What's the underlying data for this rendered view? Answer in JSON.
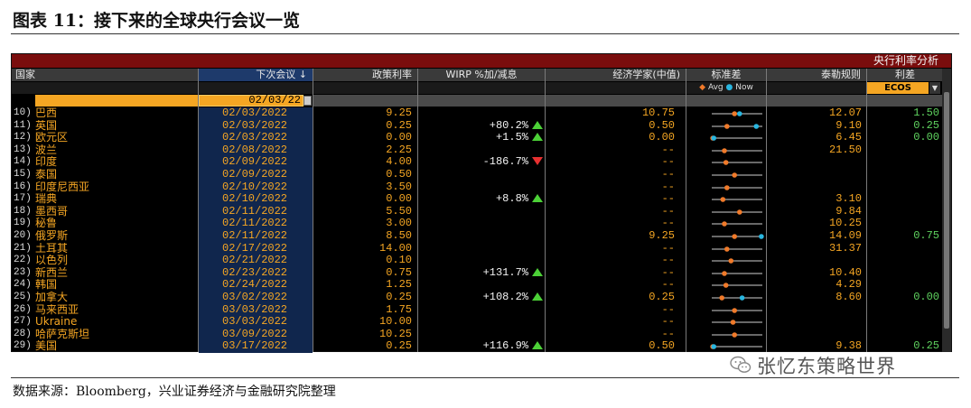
{
  "figure_title": "图表 11：接下来的全球央行会议一览",
  "terminal": {
    "banner_title": "央行利率分析",
    "columns": {
      "country": "国家",
      "next_meeting": "下次会议 ↓",
      "policy_rate": "政策利率",
      "wirp": "WIRP %加/减息",
      "economists": "经济学家(中值)",
      "stdev": "标准差",
      "taylor": "泰勒规则",
      "spread": "利差"
    },
    "legend": {
      "avg": "Avg",
      "now": "Now"
    },
    "spread_source": "ECOS",
    "filter_date": "02/03/22",
    "rows": [
      {
        "idx": "10)",
        "country": "巴西",
        "date": "02/03/2022",
        "rate": "9.25",
        "wirp": "",
        "wirp_dir": "",
        "econ": "10.75",
        "taylor": "12.07",
        "spread": "1.50",
        "avg": 0.45,
        "now": 0.55
      },
      {
        "idx": "11)",
        "country": "英国",
        "date": "02/03/2022",
        "rate": "0.25",
        "wirp": "+80.2%",
        "wirp_dir": "up",
        "econ": "0.50",
        "taylor": "9.10",
        "spread": "0.25",
        "avg": 0.3,
        "now": 0.88
      },
      {
        "idx": "12)",
        "country": "欧元区",
        "date": "02/03/2022",
        "rate": "0.00",
        "wirp": "+1.5%",
        "wirp_dir": "up",
        "econ": "0.00",
        "taylor": "6.45",
        "spread": "0.00",
        "avg": 0.02,
        "now": 0.04
      },
      {
        "idx": "13)",
        "country": "波兰",
        "date": "02/08/2022",
        "rate": "2.25",
        "wirp": "",
        "wirp_dir": "",
        "econ": "--",
        "taylor": "21.50",
        "spread": "",
        "avg": 0.25,
        "now": null
      },
      {
        "idx": "14)",
        "country": "印度",
        "date": "02/09/2022",
        "rate": "4.00",
        "wirp": "-186.7%",
        "wirp_dir": "down",
        "econ": "--",
        "taylor": "",
        "spread": "",
        "avg": 0.28,
        "now": null
      },
      {
        "idx": "15)",
        "country": "泰国",
        "date": "02/09/2022",
        "rate": "0.50",
        "wirp": "",
        "wirp_dir": "",
        "econ": "--",
        "taylor": "",
        "spread": "",
        "avg": 0.45,
        "now": null
      },
      {
        "idx": "16)",
        "country": "印度尼西亚",
        "date": "02/10/2022",
        "rate": "3.50",
        "wirp": "",
        "wirp_dir": "",
        "econ": "--",
        "taylor": "",
        "spread": "",
        "avg": 0.3,
        "now": null
      },
      {
        "idx": "17)",
        "country": "瑞典",
        "date": "02/10/2022",
        "rate": "0.00",
        "wirp": "+8.8%",
        "wirp_dir": "up",
        "econ": "--",
        "taylor": "3.10",
        "spread": "",
        "avg": 0.22,
        "now": null
      },
      {
        "idx": "18)",
        "country": "墨西哥",
        "date": "02/11/2022",
        "rate": "5.50",
        "wirp": "",
        "wirp_dir": "",
        "econ": "--",
        "taylor": "9.84",
        "spread": "",
        "avg": 0.55,
        "now": null
      },
      {
        "idx": "19)",
        "country": "秘鲁",
        "date": "02/11/2022",
        "rate": "3.00",
        "wirp": "",
        "wirp_dir": "",
        "econ": "--",
        "taylor": "10.25",
        "spread": "",
        "avg": 0.25,
        "now": null
      },
      {
        "idx": "20)",
        "country": "俄罗斯",
        "date": "02/11/2022",
        "rate": "8.50",
        "wirp": "",
        "wirp_dir": "",
        "econ": "9.25",
        "taylor": "14.09",
        "spread": "0.75",
        "avg": 0.45,
        "now": 0.98
      },
      {
        "idx": "21)",
        "country": "土耳其",
        "date": "02/17/2022",
        "rate": "14.00",
        "wirp": "",
        "wirp_dir": "",
        "econ": "--",
        "taylor": "31.37",
        "spread": "",
        "avg": 0.3,
        "now": null
      },
      {
        "idx": "22)",
        "country": "以色列",
        "date": "02/21/2022",
        "rate": "0.10",
        "wirp": "",
        "wirp_dir": "",
        "econ": "--",
        "taylor": "",
        "spread": "",
        "avg": 0.38,
        "now": null
      },
      {
        "idx": "23)",
        "country": "新西兰",
        "date": "02/23/2022",
        "rate": "0.75",
        "wirp": "+131.7%",
        "wirp_dir": "up",
        "econ": "--",
        "taylor": "10.40",
        "spread": "",
        "avg": 0.25,
        "now": null
      },
      {
        "idx": "24)",
        "country": "韩国",
        "date": "02/24/2022",
        "rate": "1.25",
        "wirp": "",
        "wirp_dir": "",
        "econ": "--",
        "taylor": "4.29",
        "spread": "",
        "avg": 0.28,
        "now": null
      },
      {
        "idx": "25)",
        "country": "加拿大",
        "date": "03/02/2022",
        "rate": "0.25",
        "wirp": "+108.2%",
        "wirp_dir": "up",
        "econ": "0.25",
        "taylor": "8.60",
        "spread": "0.00",
        "avg": 0.2,
        "now": 0.6
      },
      {
        "idx": "26)",
        "country": "马来西亚",
        "date": "03/03/2022",
        "rate": "1.75",
        "wirp": "",
        "wirp_dir": "",
        "econ": "--",
        "taylor": "",
        "spread": "",
        "avg": 0.45,
        "now": null
      },
      {
        "idx": "27)",
        "country": "Ukraine",
        "date": "03/03/2022",
        "rate": "10.00",
        "wirp": "",
        "wirp_dir": "",
        "econ": "--",
        "taylor": "",
        "spread": "",
        "avg": 0.42,
        "now": null
      },
      {
        "idx": "28)",
        "country": "哈萨克斯坦",
        "date": "03/09/2022",
        "rate": "10.25",
        "wirp": "",
        "wirp_dir": "",
        "econ": "--",
        "taylor": "",
        "spread": "",
        "avg": 0.45,
        "now": null
      },
      {
        "idx": "29)",
        "country": "美国",
        "date": "03/17/2022",
        "rate": "0.25",
        "wirp": "+116.9%",
        "wirp_dir": "up",
        "econ": "0.50",
        "taylor": "9.38",
        "spread": "0.25",
        "avg": 0.02,
        "now": 0.04
      }
    ]
  },
  "colors": {
    "banner": "#7a0d0d",
    "accent_orange": "#f5a623",
    "positive_green": "#5fd35f",
    "up_triangle": "#4cd137",
    "down_triangle": "#e83030",
    "avg_dot": "#f07a2a",
    "now_dot": "#29b6e0"
  },
  "source_note": "数据来源：Bloomberg，兴业证券经济与金融研究院整理",
  "watermark": {
    "icon": "wechat-icon",
    "text": "张忆东策略世界"
  }
}
